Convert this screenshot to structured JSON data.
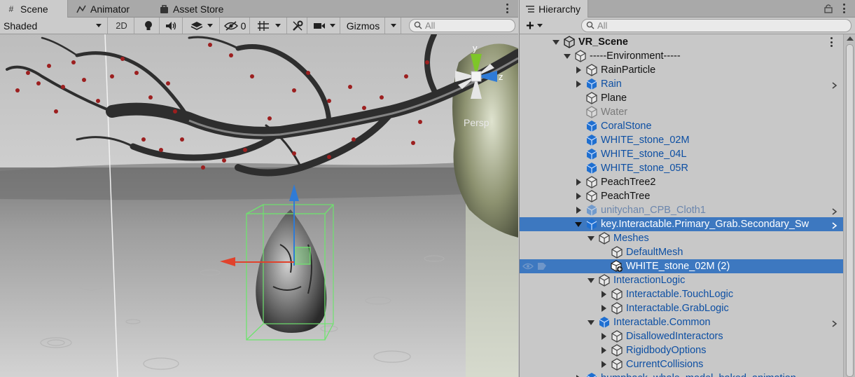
{
  "scene_panel": {
    "tabs": [
      {
        "label": "Scene",
        "icon": "grid-icon"
      },
      {
        "label": "Animator",
        "icon": "animator-icon"
      },
      {
        "label": "Asset Store",
        "icon": "bag-icon"
      }
    ],
    "toolbar": {
      "shading_mode": "Shaded",
      "mode_2d": "2D",
      "hidden_count": "0",
      "gizmos_label": "Gizmos",
      "search_placeholder": "All"
    },
    "viewport": {
      "projection_label": "Persp",
      "gizmo_axes": {
        "y": "y",
        "z": "z"
      }
    }
  },
  "hierarchy_panel": {
    "tab_label": "Hierarchy",
    "search_placeholder": "All",
    "add_label": "+",
    "rows": [
      {
        "label": "VR_Scene",
        "depth": 0,
        "fold": "down",
        "icon": "unity-scene-icon",
        "style": "bold"
      },
      {
        "label": "-----Environment-----",
        "depth": 1,
        "fold": "down",
        "icon": "cube-outline-icon",
        "style": "normal"
      },
      {
        "label": "RainParticle",
        "depth": 2,
        "fold": "right",
        "icon": "cube-outline-icon",
        "style": "normal"
      },
      {
        "label": "Rain",
        "depth": 2,
        "fold": "right",
        "icon": "prefab-cube-icon",
        "style": "prefab",
        "chevron": true
      },
      {
        "label": "Plane",
        "depth": 2,
        "fold": "none",
        "icon": "cube-outline-icon",
        "style": "normal"
      },
      {
        "label": "Water",
        "depth": 2,
        "fold": "none",
        "icon": "cube-outline-icon",
        "style": "disabled"
      },
      {
        "label": "CoralStone",
        "depth": 2,
        "fold": "none",
        "icon": "prefab-cube-icon",
        "style": "prefab"
      },
      {
        "label": "WHITE_stone_02M",
        "depth": 2,
        "fold": "none",
        "icon": "prefab-cube-icon",
        "style": "prefab"
      },
      {
        "label": "WHITE_stone_04L",
        "depth": 2,
        "fold": "none",
        "icon": "prefab-cube-icon",
        "style": "prefab"
      },
      {
        "label": "WHITE_stone_05R",
        "depth": 2,
        "fold": "none",
        "icon": "prefab-cube-icon",
        "style": "prefab"
      },
      {
        "label": "PeachTree2",
        "depth": 2,
        "fold": "right",
        "icon": "cube-outline-icon",
        "style": "normal"
      },
      {
        "label": "PeachTree",
        "depth": 2,
        "fold": "right",
        "icon": "cube-outline-icon",
        "style": "normal"
      },
      {
        "label": "unitychan_CPB_Cloth1",
        "depth": 2,
        "fold": "right",
        "icon": "prefab-cube-icon",
        "style": "prefab-disabled",
        "chevron": true
      },
      {
        "label": "key.Interactable.Primary_Grab.Secondary_Sw",
        "depth": 2,
        "fold": "down",
        "icon": "prefab-cube-icon",
        "style": "normal",
        "selected": true,
        "chevron": true
      },
      {
        "label": "Meshes",
        "depth": 3,
        "fold": "down",
        "icon": "cube-outline-icon",
        "style": "prefab"
      },
      {
        "label": "DefaultMesh",
        "depth": 4,
        "fold": "none",
        "icon": "cube-outline-icon",
        "style": "prefab"
      },
      {
        "label": "WHITE_stone_02M (2)",
        "depth": 4,
        "fold": "none",
        "icon": "prefab-add-icon",
        "style": "normal",
        "selected": true
      },
      {
        "label": "InteractionLogic",
        "depth": 3,
        "fold": "down",
        "icon": "cube-outline-icon",
        "style": "prefab"
      },
      {
        "label": "Interactable.TouchLogic",
        "depth": 4,
        "fold": "right",
        "icon": "cube-outline-icon",
        "style": "prefab"
      },
      {
        "label": "Interactable.GrabLogic",
        "depth": 4,
        "fold": "right",
        "icon": "cube-outline-icon",
        "style": "prefab"
      },
      {
        "label": "Interactable.Common",
        "depth": 3,
        "fold": "down",
        "icon": "prefab-cube-icon",
        "style": "prefab",
        "chevron": true
      },
      {
        "label": "DisallowedInteractors",
        "depth": 4,
        "fold": "right",
        "icon": "cube-outline-icon",
        "style": "prefab"
      },
      {
        "label": "RigidbodyOptions",
        "depth": 4,
        "fold": "right",
        "icon": "cube-outline-icon",
        "style": "prefab"
      },
      {
        "label": "CurrentCollisions",
        "depth": 4,
        "fold": "right",
        "icon": "cube-outline-icon",
        "style": "prefab"
      },
      {
        "label": "humpback_whale_model_baked_animation",
        "depth": 2,
        "fold": "right",
        "icon": "prefab-cube-icon",
        "style": "prefab"
      }
    ]
  },
  "colors": {
    "selection": "#3d78c0",
    "prefab_text": "#0d4fa3",
    "gizmo_y": "#7ec629",
    "gizmo_z": "#2f7bd6",
    "gizmo_x": "#e0422c",
    "bounds_box": "#6ee36e"
  }
}
